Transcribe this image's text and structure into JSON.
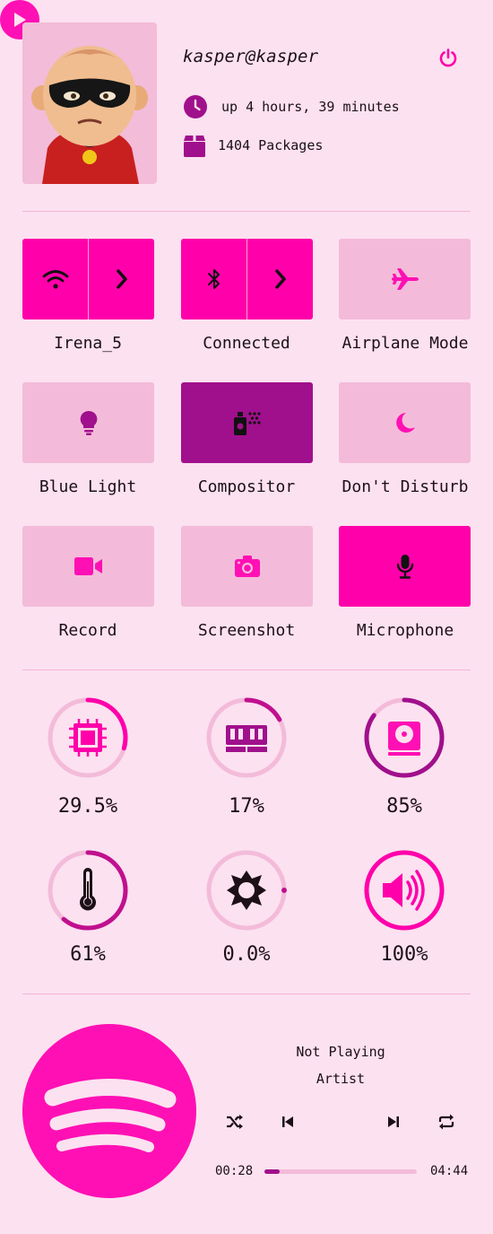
{
  "colors": {
    "background": "#fce1f0",
    "accent": "#ff00aa",
    "accent_dark": "#a0108c",
    "tile_off": "#f3bbd9"
  },
  "header": {
    "username": "kasper@kasper",
    "uptime": "up 4 hours, 39 minutes",
    "packages": "1404 Packages"
  },
  "quick_settings": [
    {
      "label": "Irena_5",
      "icon": "wifi-icon",
      "state": "on",
      "has_arrow": true
    },
    {
      "label": "Connected",
      "icon": "bluetooth-icon",
      "state": "on",
      "has_arrow": true
    },
    {
      "label": "Airplane Mode",
      "icon": "airplane-icon",
      "state": "off"
    },
    {
      "label": "Blue Light",
      "icon": "lightbulb-icon",
      "state": "off"
    },
    {
      "label": "Compositor",
      "icon": "spray-can-icon",
      "state": "active"
    },
    {
      "label": "Don't Disturb",
      "icon": "moon-icon",
      "state": "off"
    },
    {
      "label": "Record",
      "icon": "video-camera-icon",
      "state": "off"
    },
    {
      "label": "Screenshot",
      "icon": "camera-icon",
      "state": "off"
    },
    {
      "label": "Microphone",
      "icon": "microphone-icon",
      "state": "on"
    }
  ],
  "stats": [
    {
      "name": "cpu",
      "icon": "cpu-icon",
      "value": "29.5%",
      "fraction": 0.295
    },
    {
      "name": "ram",
      "icon": "ram-icon",
      "value": "17%",
      "fraction": 0.17
    },
    {
      "name": "disk",
      "icon": "disk-icon",
      "value": "85%",
      "fraction": 0.85
    },
    {
      "name": "temperature",
      "icon": "thermometer-icon",
      "value": "61%",
      "fraction": 0.61
    },
    {
      "name": "brightness",
      "icon": "brightness-icon",
      "value": "0.0%",
      "fraction": 0.0
    },
    {
      "name": "volume",
      "icon": "volume-icon",
      "value": "100%",
      "fraction": 1.0
    }
  ],
  "player": {
    "title": "Not Playing",
    "artist": "Artist",
    "elapsed": "00:28",
    "total": "04:44",
    "progress": 0.1
  }
}
